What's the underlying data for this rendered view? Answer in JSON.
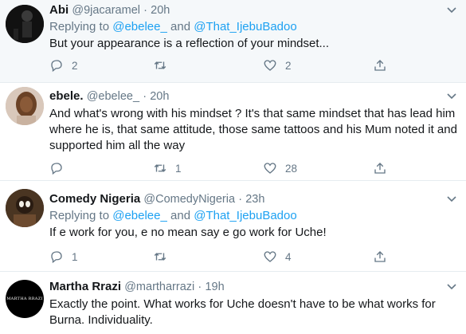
{
  "tweets": [
    {
      "name": "Abi",
      "handle": "@9jacaramel",
      "time": "20h",
      "replying_prefix": "Replying to",
      "replying_to": [
        "@ebelee_",
        "@That_IjebuBadoo"
      ],
      "replying_join": "and",
      "text": "But your appearance is a reflection of your mindset...",
      "reply_count": "2",
      "retweet_count": "",
      "like_count": "2"
    },
    {
      "name": "ebele.",
      "handle": "@ebelee_",
      "time": "20h",
      "text": "And what's wrong with his mindset ? It's that same mindset that has lead him where he is, that same attitude, those same tattoos and his Mum noted it and supported him all the way",
      "reply_count": "",
      "retweet_count": "1",
      "like_count": "28"
    },
    {
      "name": "Comedy Nigeria",
      "handle": "@ComedyNigeria",
      "time": "23h",
      "replying_prefix": "Replying to",
      "replying_to": [
        "@ebelee_",
        "@That_IjebuBadoo"
      ],
      "replying_join": "and",
      "text": "If e work for you, e no mean say e go work for Uche!",
      "reply_count": "1",
      "retweet_count": "",
      "like_count": "4"
    },
    {
      "name": "Martha Rrazi",
      "handle": "@martharrazi",
      "time": "19h",
      "avatar_text": "MARTHA RRAZI",
      "text": "Exactly the point. What works for Uche doesn't have to be what works for Burna. Individuality."
    }
  ],
  "separator": "·",
  "colors": {
    "accent": "#1da1f2",
    "muted": "#657786",
    "text": "#14171a",
    "highlight_bg": "#f5f8fa"
  },
  "icons": [
    "chevron-down-icon",
    "reply-icon",
    "retweet-icon",
    "like-icon",
    "share-icon"
  ]
}
